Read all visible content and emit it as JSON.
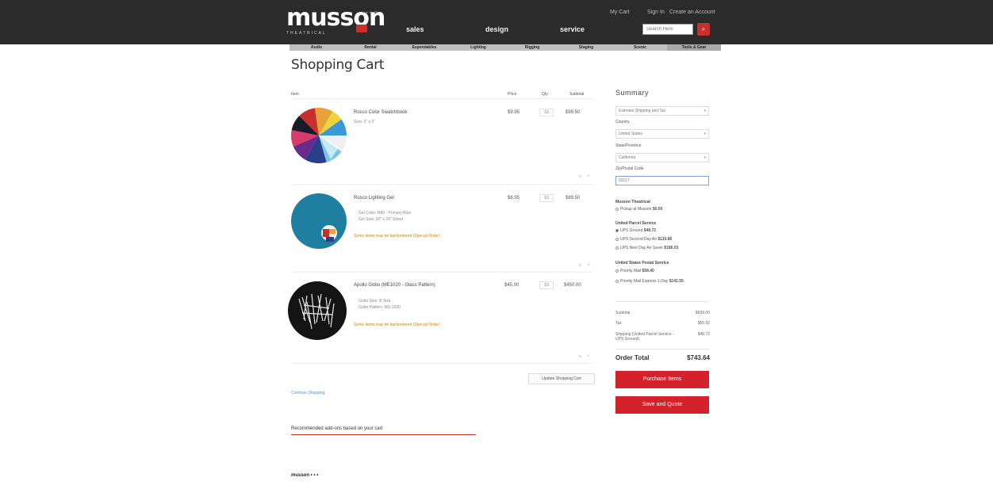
{
  "header": {
    "logo_text": "musson",
    "logo_subtext": "THEATRICAL",
    "logo_dot": "• • • ↗",
    "nav": [
      "sales",
      "design",
      "service"
    ],
    "util_links": [
      "My Cart",
      "Sign In",
      "Create an Account"
    ],
    "search_placeholder": "Search Here",
    "search_icon_glyph": "⌕",
    "accent_color": "#c8302e"
  },
  "subnav": [
    "Audio",
    "Rental",
    "Expendables",
    "Lighting",
    "Rigging",
    "Staging",
    "Scenic",
    "Tools & Gear"
  ],
  "page_title": "Shopping Cart",
  "cart": {
    "headers": {
      "item": "Item",
      "price": "Price",
      "qty": "Qty",
      "subtotal": "Subtotal"
    },
    "items": [
      {
        "name": "Rosco Color Swatchbook",
        "options": [
          "Size: 3\" x 5\""
        ],
        "notice": "",
        "price": "$9.95",
        "qty": "10",
        "subtotal": "$99.50"
      },
      {
        "name": "Rosco Lighting Gel",
        "options": [
          "Gel Color: R80 - Primary Blue",
          "Gel Size: 20\" x 24\" Sheet"
        ],
        "notice": "Some items may be backordered (Special Order)",
        "price": "$8.95",
        "qty": "10",
        "subtotal": "$89.50"
      },
      {
        "name": "Apollo Gobo (ME1020 - Glass Pattern)",
        "options": [
          "Gobo Size: B Size",
          "Gobo Pattern: MS-1020"
        ],
        "notice": "Some items may be backordered (Special Order)",
        "price": "$45.00",
        "qty": "10",
        "subtotal": "$450.00"
      }
    ],
    "row_actions": [
      "✎",
      "×"
    ],
    "update_button": "Update Shopping Cart",
    "continue_link": "Continue Shopping",
    "recommend_heading": "Recommended add-ons based on your cart",
    "footer_logo": "musson • • •"
  },
  "summary": {
    "title": "Summary",
    "estimate_label": "Estimate Shipping and Tax",
    "country_label": "Country",
    "country_value": "United States",
    "state_label": "State/Province",
    "state_value": "California",
    "zip_label": "Zip/Postal Code",
    "zip_value": "93117",
    "groups": [
      {
        "name": "Musson Theatrical",
        "options": [
          {
            "label": "Pickup at Musson",
            "price": "$0.00",
            "selected": false
          }
        ]
      },
      {
        "name": "United Parcel Service",
        "options": [
          {
            "label": "UPS Ground",
            "price": "$48.72",
            "selected": true
          },
          {
            "label": "UPS Second Day Air",
            "price": "$110.86",
            "selected": false
          },
          {
            "label": "UPS Next Day Air Saver",
            "price": "$186.03",
            "selected": false
          }
        ]
      },
      {
        "name": "United States Postal Service",
        "options": [
          {
            "label": "Priority Mail",
            "price": "$58.40",
            "selected": false
          },
          {
            "label": "Priority Mail Express 1-Day",
            "price": "$142.55",
            "selected": false
          }
        ]
      }
    ],
    "lines": [
      {
        "label": "Subtotal",
        "value": "$639.00"
      },
      {
        "label": "Tax",
        "value": "$55.92"
      },
      {
        "label": "Shipping (United Parcel Service - UPS Ground)",
        "value": "$48.72"
      }
    ],
    "order_total_label": "Order Total",
    "order_total_value": "$743.64",
    "checkout_button": "Purchase Items",
    "quote_button": "Save and Quote",
    "button_color": "#d3222a"
  }
}
